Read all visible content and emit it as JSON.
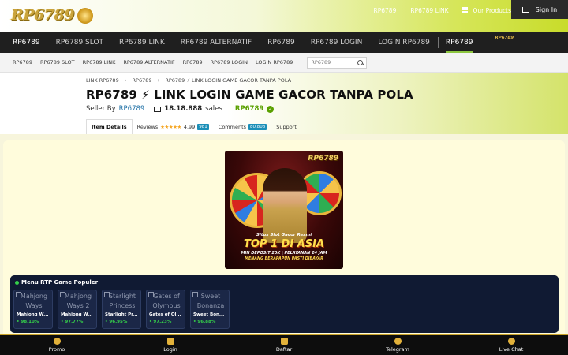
{
  "header": {
    "logo_text": "RP6789",
    "top_links": [
      "RP6789",
      "RP6789 LINK"
    ],
    "products_label": "Our Products",
    "signin_label": "Sign In"
  },
  "main_nav": {
    "items": [
      "RP6789",
      "RP6789 SLOT",
      "RP6789 LINK",
      "RP6789 ALTERNATIF",
      "RP6789",
      "RP6789 LOGIN",
      "LOGIN RP6789"
    ],
    "active": "RP6789",
    "mini_logo": "RP6789"
  },
  "sub_nav": {
    "items": [
      "RP6789",
      "RP6789 SLOT",
      "RP6789 LINK",
      "RP6789 ALTERNATIF",
      "RP6789",
      "RP6789 LOGIN",
      "LOGIN RP6789"
    ],
    "search_placeholder": "RP6789"
  },
  "breadcrumb": [
    "LINK RP6789",
    "RP6789",
    "RP6789 ⚡ LINK LOGIN GAME GACOR TANPA POLA"
  ],
  "product": {
    "title": "RP6789 ⚡ LINK LOGIN GAME GACOR TANPA POLA",
    "seller_prefix": "Seller By",
    "seller_name": "RP6789",
    "sales_count": "18.18.888",
    "sales_label": "sales",
    "brand": "RP6789"
  },
  "tabs": {
    "item_details": "Item Details",
    "reviews_label": "Reviews",
    "stars": "★★★★★",
    "rating": "4.99",
    "reviews_count": "981",
    "comments_label": "Comments",
    "comments_count": "80.808",
    "support_label": "Support"
  },
  "banner": {
    "logo": "RP6789",
    "subtitle": "Situs Slot Gacor Resmi",
    "headline": "TOP 1 DI ASIA",
    "line1": "MIN DEPOSIT 20K | PELAYANAN 24 JAM",
    "line2": "MENANG BERAPAPUN PASTI DIBAYAR"
  },
  "rtp": {
    "title": "Menu RTP Game Populer",
    "games": [
      {
        "img_alt": "Mahjong Ways",
        "name": "Mahjong W...",
        "rtp": "• 98.10%"
      },
      {
        "img_alt": "Mahjong Ways 2",
        "name": "Mahjong W...",
        "rtp": "• 97.77%"
      },
      {
        "img_alt": "Starlight Princess",
        "name": "Starlight Pr...",
        "rtp": "• 96.95%"
      },
      {
        "img_alt": "Gates of Olympus",
        "name": "Gates of Ol...",
        "rtp": "• 97.23%"
      },
      {
        "img_alt": "Sweet Bonanza",
        "name": "Sweet Bon...",
        "rtp": "• 96.88%"
      }
    ]
  },
  "bottom_bar": [
    "Promo",
    "Login",
    "Daftar",
    "Telegram",
    "Live Chat"
  ],
  "colors": {
    "accent_green": "#8cc63f",
    "dark_nav": "#1f1f1f",
    "gold": "#e2b13a",
    "rtp_bg": "#101a33"
  }
}
